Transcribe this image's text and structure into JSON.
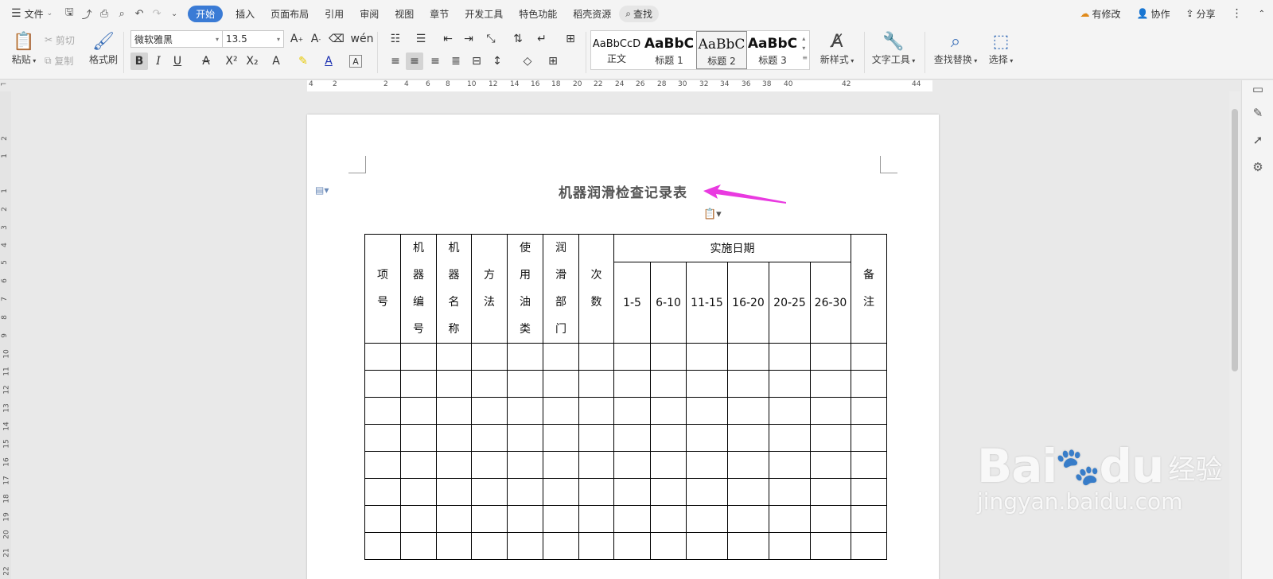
{
  "menu": {
    "file": "文件",
    "tabs": [
      "开始",
      "插入",
      "页面布局",
      "引用",
      "审阅",
      "视图",
      "章节",
      "开发工具",
      "特色功能",
      "稻壳资源"
    ],
    "active_tab": "开始",
    "search": "查找",
    "has_changes": "有修改",
    "collaborate": "协作",
    "share": "分享"
  },
  "ribbon": {
    "paste": "粘贴",
    "cut": "剪切",
    "copy": "复制",
    "format_painter": "格式刷",
    "font_name": "微软雅黑",
    "font_size": "13.5",
    "styles": [
      {
        "sample": "AaBbCcD",
        "name": "正文"
      },
      {
        "sample": "AaBbC",
        "name": "标题 1"
      },
      {
        "sample": "AaBbC",
        "name": "标题 2"
      },
      {
        "sample": "AaBbC",
        "name": "标题 3"
      }
    ],
    "selected_style": "标题 2",
    "new_style": "新样式",
    "text_tools": "文字工具",
    "find_replace": "查找替换",
    "select": "选择"
  },
  "ruler": {
    "h_ticks": [
      "4",
      "2",
      "2",
      "4",
      "6",
      "8",
      "10",
      "12",
      "14",
      "16",
      "18",
      "20",
      "22",
      "24",
      "26",
      "28",
      "30",
      "32",
      "34",
      "36",
      "38",
      "40",
      "42",
      "44"
    ],
    "v_ticks": [
      "2",
      "1",
      "1",
      "2",
      "3",
      "4",
      "5",
      "6",
      "7",
      "8",
      "9",
      "10",
      "11",
      "12",
      "13",
      "14",
      "15",
      "16",
      "17",
      "18",
      "19",
      "20",
      "21",
      "22"
    ]
  },
  "document": {
    "title": "机器润滑检查记录表",
    "table": {
      "headers": [
        "项号",
        "机器编号",
        "机器名称",
        "方法",
        "使用油类",
        "润滑部门",
        "次数"
      ],
      "group_header": "实施日期",
      "date_ranges": [
        "1-5",
        "6-10",
        "11-15",
        "16-20",
        "20-25",
        "26-30"
      ],
      "remark": "备注",
      "empty_rows": 8
    }
  },
  "colors": {
    "accent": "#3a7bd5",
    "arrow": "#e93ae0"
  },
  "watermark": {
    "brand": "Bai",
    "brand2": "du",
    "cn": "经验",
    "url": "jingyan.baidu.com"
  }
}
